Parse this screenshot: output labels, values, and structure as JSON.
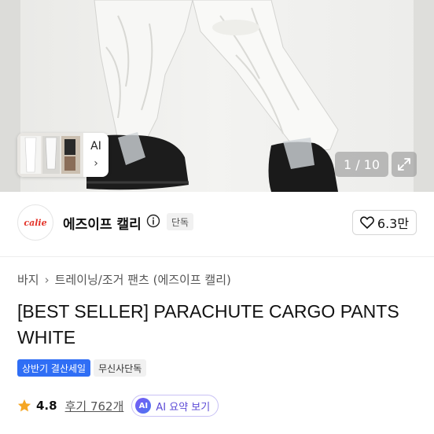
{
  "gallery": {
    "counter": "1 / 10",
    "thumbnail_ai_label": "AI",
    "thumbnail_chevron": "›",
    "icons": {
      "expand": "expand-icon",
      "chevron": "chevron-right-icon"
    }
  },
  "brand": {
    "logo_text": "calie",
    "name": "에즈이프 캘리",
    "exclusive_tag": "단독",
    "like_count": "6.3만",
    "icons": {
      "info": "info-icon",
      "like": "heart-outline-icon"
    }
  },
  "breadcrumb": {
    "category": "바지",
    "separator": "›",
    "subcategory": "트레이닝/조거 팬츠 (에즈이프 캘리)"
  },
  "product": {
    "title": "[BEST SELLER] PARACHUTE CARGO PANTS WHITE",
    "badges": [
      "상반기 결산세일",
      "무신사단독"
    ]
  },
  "reviews": {
    "rating": "4.8",
    "review_link": "후기 762개",
    "ai_chip": "AI",
    "ai_summary_label": "AI 요약 보기",
    "star_color": "#f5a623"
  },
  "colors": {
    "accent_blue": "#2f6ef5",
    "ai_purple": "#5b4ad6"
  }
}
